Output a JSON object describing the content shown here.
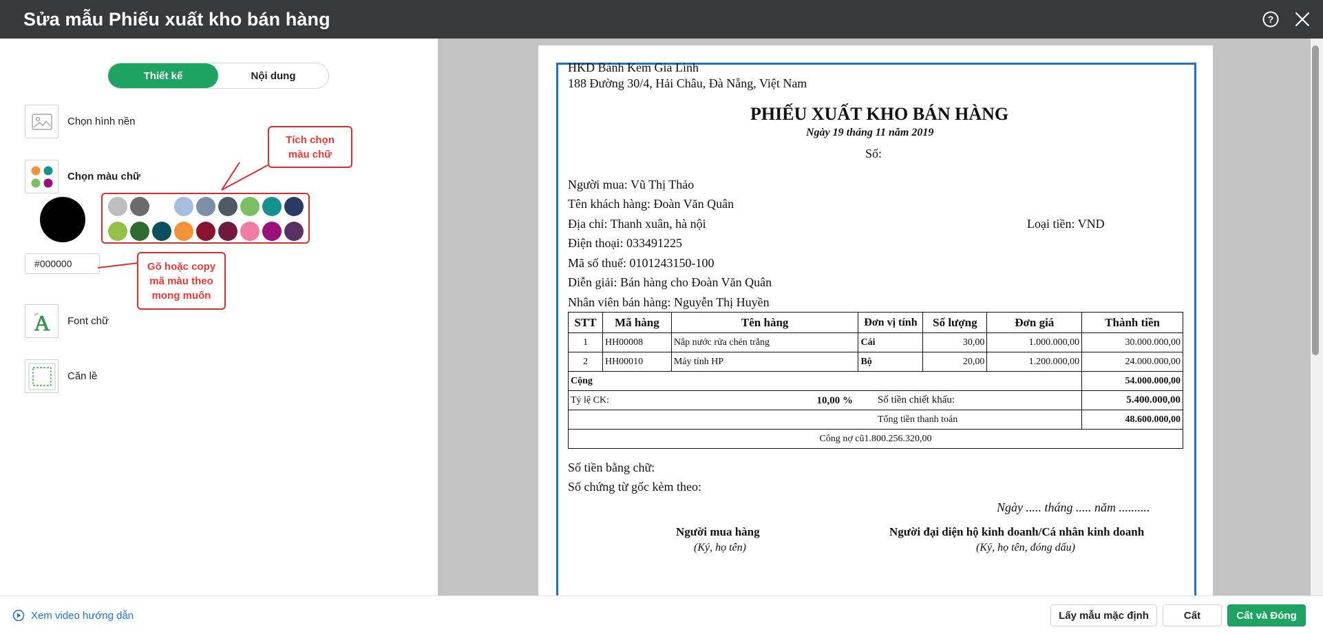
{
  "header": {
    "title": "Sửa mẫu Phiếu xuất kho bán hàng",
    "help_icon": "question-circle-icon",
    "close_icon": "close-icon"
  },
  "left_panel": {
    "tabs": [
      {
        "label": "Thiết kế",
        "active": true
      },
      {
        "label": "Nội dung",
        "active": false
      }
    ],
    "options": {
      "background": "Chọn hình nền",
      "text_color": "Chọn màu chữ",
      "font": "Font chữ",
      "margin": "Căn lề"
    },
    "selected_color": "#000000",
    "hex_value": "#000000",
    "palette": [
      "#bdbdbd",
      "#6b6b6b",
      "#ffffff",
      "#a6bddf",
      "#7b8fa6",
      "#4d5a63",
      "#7bbf62",
      "#12918e",
      "#2b3a63",
      "#93c047",
      "#2f6a2f",
      "#0d4e5c",
      "#f4923a",
      "#8a1230",
      "#6e1a3f",
      "#f27ba3",
      "#9b0f7a",
      "#5a3063"
    ],
    "callout_color": "Tích chọn\nmàu chữ",
    "callout_hex": "Gõ hoặc copy\nmã màu theo\nmong muốn",
    "guide_link": "Xem video hướng dẫn"
  },
  "document": {
    "company_name": "HKD Bánh Kem Gia Linh",
    "company_address": "188 Đường 30/4, Hải Châu, Đà Nẵng, Việt Nam",
    "title": "PHIẾU XUẤT KHO BÁN HÀNG",
    "date_line": "Ngày 19 tháng 11 năm 2019",
    "number_label": "Số:",
    "buyer": "Người mua: Vũ Thị Thảo",
    "customer": "Tên khách hàng: Đoàn Văn Quân",
    "address": "Địa chỉ: Thanh xuân, hà nội",
    "currency": "Loại tiền: VND",
    "phone": "Điện thoại: 033491225",
    "tax_code": "Mã số thuế: 0101243150-100",
    "description": "Diễn giải: Bán hàng cho Đoàn Văn Quân",
    "salesperson": "Nhân viên bán hàng: Nguyễn Thị Huyền",
    "table": {
      "headers": [
        "STT",
        "Mã hàng",
        "Tên hàng",
        "Đơn vị tính",
        "Số lượng",
        "Đơn giá",
        "Thành tiền"
      ],
      "rows": [
        {
          "stt": "1",
          "code": "HH00008",
          "name": "Nắp nước rửa chén trắng",
          "unit": "Cái",
          "qty": "30,00",
          "price": "1.000.000,00",
          "amount": "30.000.000,00"
        },
        {
          "stt": "2",
          "code": "HH00010",
          "name": "Máy tính HP",
          "unit": "Bộ",
          "qty": "20,00",
          "price": "1.200.000,00",
          "amount": "24.000.000,00"
        }
      ],
      "total_label": "Cộng",
      "total_value": "54.000.000,00",
      "discount_rate_label": "Tỷ lệ CK:",
      "discount_rate_value": "10,00 %",
      "discount_amount_label": "Số tiền chiết khấu:",
      "discount_amount_value": "5.400.000,00",
      "grand_total_label": "Tổng tiền thanh toán",
      "grand_total_value": "48.600.000,00",
      "old_debt": "Công nợ cũ1.800.256.320,00"
    },
    "amount_in_words": "Số tiền bằng chữ:",
    "attached_docs": "Số chứng từ gốc kèm theo:",
    "sign_date": "Ngày ..... tháng ..... năm ..........",
    "buyer_sign_title": "Người mua hàng",
    "buyer_sign_note": "(Ký, họ tên)",
    "rep_sign_title": "Người đại diện hộ kinh doanh/Cá nhân kinh doanh",
    "rep_sign_note": "(Ký, họ tên, đóng dấu)"
  },
  "footer": {
    "default_btn": "Lấy mẫu mặc định",
    "save_btn": "Cất",
    "save_close_btn": "Cất và Đóng"
  }
}
